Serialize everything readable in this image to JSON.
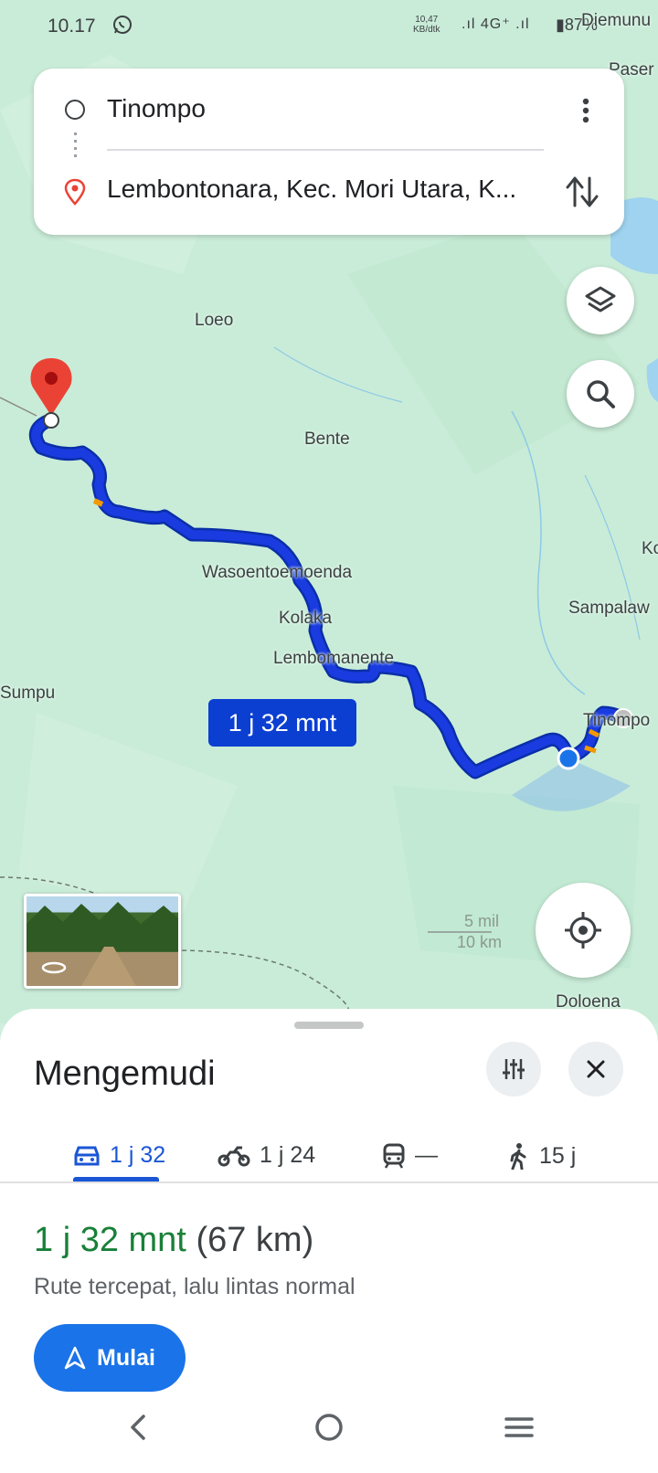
{
  "status_bar": {
    "time": "10.17",
    "net_speed_value": "10,47",
    "net_speed_unit": "KB/dtk",
    "signal": ".ıl 4G⁺ .ıl",
    "battery": "87%"
  },
  "search": {
    "origin": "Tinompo",
    "destination": "Lembontonara, Kec. Mori Utara, K..."
  },
  "map": {
    "labels": {
      "loeo": "Loeo",
      "bente": "Bente",
      "wasoento": "Wasoentoemoenda",
      "kolaka": "Kolaka",
      "lembomanente": "Lembomanente",
      "sumpu": "Sumpu",
      "sampalaw": "Sampalaw",
      "tinompo": "Tinompo",
      "diemunu": "Diemunu",
      "pasera": "Paser",
      "ko": "Ko",
      "dolaena": "Doloena"
    },
    "eta_chip": "1 j 32 mnt",
    "scale_top": "5 mil",
    "scale_bottom": "10 km",
    "route_color": "#1a3be0"
  },
  "sheet": {
    "title": "Mengemudi",
    "tabs": [
      {
        "icon": "car-icon",
        "label": "1 j 32",
        "active": true
      },
      {
        "icon": "motorcycle-icon",
        "label": "1 j 24"
      },
      {
        "icon": "transit-icon",
        "label": "—"
      },
      {
        "icon": "walk-icon",
        "label": "15 j"
      }
    ],
    "duration": "1 j 32 mnt",
    "distance": "(67 km)",
    "route_desc": "Rute tercepat, lalu lintas normal",
    "start_label": "Mulai"
  },
  "colors": {
    "accent": "#1a73e8",
    "route": "#1a3be0",
    "duration_green": "#188038",
    "pin_red": "#ea4335"
  }
}
